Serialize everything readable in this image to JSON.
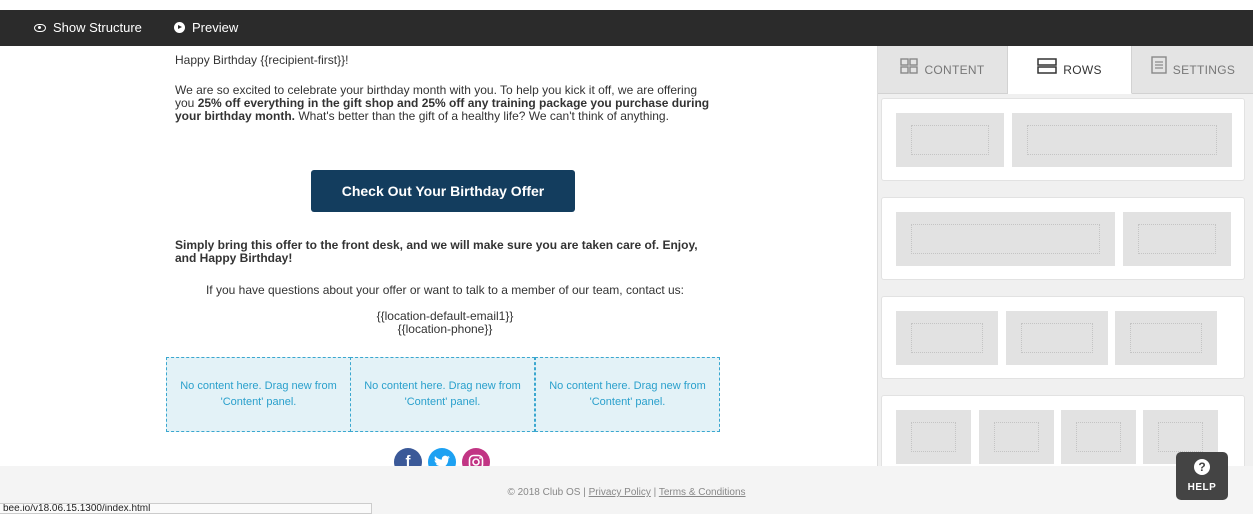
{
  "toolbar": {
    "show_structure": "Show Structure",
    "preview": "Preview"
  },
  "email": {
    "greeting": "Happy Birthday {{recipient-first}}!",
    "intro_1": "We are so excited to celebrate your birthday month with you. To help you kick it off, we are offering you ",
    "intro_bold": "25% off everything in the gift shop and 25% off any training package you purchase during your birthday month.",
    "intro_2": " What's better than the gift of a healthy life? We can't think of anything.",
    "cta_label": "Check Out Your Birthday Offer",
    "bring_offer": "Simply bring this offer to the front desk, and we will make sure you are taken care of. Enjoy, and Happy Birthday!",
    "questions": "If you have questions about your offer or want to talk to a member of our team, contact us:",
    "email_var": "{{location-default-email1}}",
    "phone_var": "{{location-phone}}",
    "placeholders": [
      "No content here. Drag new from 'Content' panel.",
      "No content here. Drag new from 'Content' panel.",
      "No content here. Drag new from 'Content' panel."
    ],
    "social": [
      {
        "name": "facebook-icon",
        "glyph": "f",
        "color": "#3b5998"
      },
      {
        "name": "twitter-icon",
        "glyph": "t",
        "color": "#1da1f2"
      },
      {
        "name": "instagram-icon",
        "glyph": "◎",
        "color": "#c13584"
      }
    ]
  },
  "panel": {
    "tabs": [
      {
        "label": "CONTENT",
        "icon": "grid-icon",
        "active": false
      },
      {
        "label": "ROWS",
        "icon": "rows-icon",
        "active": true
      },
      {
        "label": "SETTINGS",
        "icon": "settings-doc-icon",
        "active": false
      }
    ]
  },
  "footer": {
    "copyright": "© 2018 Club OS | ",
    "privacy": "Privacy Policy",
    "separator": " | ",
    "terms": "Terms & Conditions"
  },
  "status_url": "bee.io/v18.06.15.1300/index.html",
  "help_label": "HELP",
  "colors": {
    "topbar": "#2b2b2b",
    "cta": "#133d5e",
    "placeholder_bg": "#e3f2f7",
    "placeholder_text": "#2aa0cc"
  }
}
